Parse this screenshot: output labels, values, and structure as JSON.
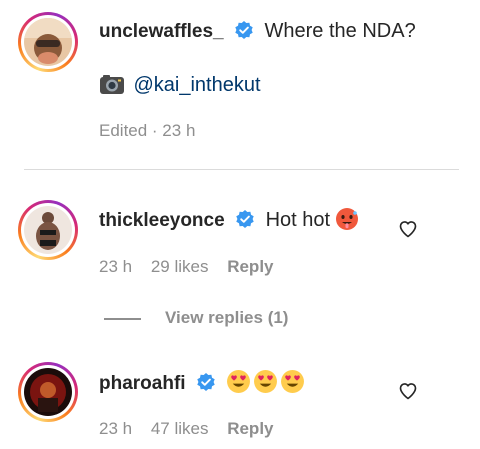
{
  "comments": [
    {
      "username": "unclewaffles_",
      "text": "Where the NDA?",
      "caption_icon": "camera-icon",
      "mention": "@kai_inthekut",
      "meta": "Edited · 23 h"
    },
    {
      "username": "thickleeyonce",
      "text": "Hot hot",
      "emoji": "hot-face-emoji",
      "time": "23 h",
      "likes": "29 likes",
      "reply": "Reply"
    },
    {
      "username": "pharoahfi",
      "emoji": "heart-eyes-emoji",
      "time": "23 h",
      "likes": "47 likes",
      "reply": "Reply"
    }
  ],
  "view_replies": "View replies (1)",
  "colors": {
    "verified": "#3897f0",
    "secondary_text": "#8e8e8e",
    "mention": "#00376b"
  }
}
